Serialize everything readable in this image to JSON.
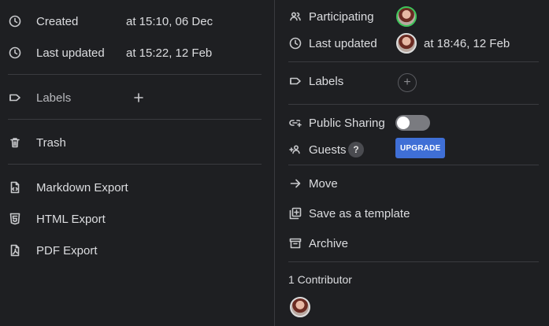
{
  "left_panel": {
    "created": {
      "label": "Created",
      "value": "at 15:10, 06 Dec",
      "icon": "clock-icon"
    },
    "last_updated": {
      "label": "Last updated",
      "value": "at 15:22, 12 Feb",
      "icon": "clock-icon"
    },
    "labels": {
      "label": "Labels",
      "icon": "tag-icon",
      "add_icon": "plus-icon"
    },
    "trash": {
      "label": "Trash",
      "icon": "trash-icon"
    },
    "exports": [
      {
        "label": "Markdown Export",
        "icon": "markdown-file-icon"
      },
      {
        "label": "HTML Export",
        "icon": "html5-icon"
      },
      {
        "label": "PDF Export",
        "icon": "pdf-file-icon"
      }
    ]
  },
  "right_panel": {
    "participating": {
      "label": "Participating",
      "icon": "users-icon"
    },
    "last_updated": {
      "label": "Last updated",
      "value": "at 18:46, 12 Feb",
      "icon": "clock-icon"
    },
    "labels": {
      "label": "Labels",
      "add_symbol": "+"
    },
    "public_sharing": {
      "label": "Public Sharing",
      "enabled": false
    },
    "guests": {
      "label": "Guests",
      "help": "?",
      "upgrade_label": "UPGRADE"
    },
    "actions": [
      {
        "label": "Move",
        "icon": "arrow-right-icon"
      },
      {
        "label": "Save as a template",
        "icon": "template-add-icon"
      },
      {
        "label": "Archive",
        "icon": "archive-icon"
      }
    ],
    "contributors": {
      "label": "1 Contributor"
    }
  },
  "colors": {
    "background": "#1e1f22",
    "divider": "#3a3b3f",
    "upgrade": "#3f6fd6",
    "active_ring": "#3ec45a"
  }
}
